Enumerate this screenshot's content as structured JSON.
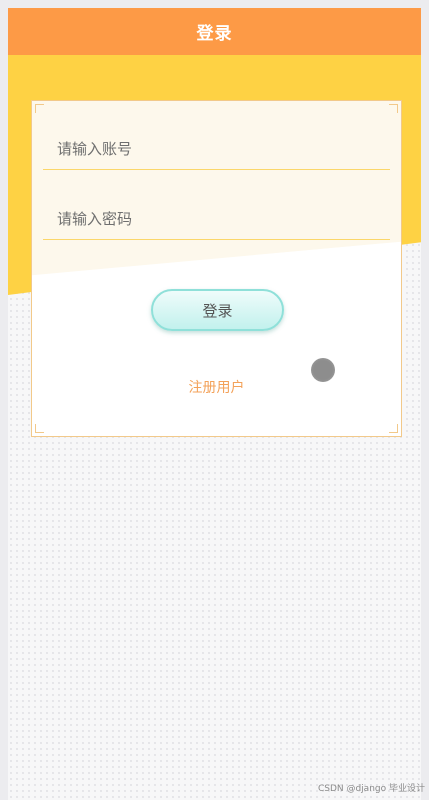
{
  "header": {
    "title": "登录"
  },
  "form": {
    "account_placeholder": "请输入账号",
    "password_placeholder": "请输入密码",
    "login_label": "登录",
    "register_label": "注册用户"
  },
  "watermark": "CSDN @django 毕业设计",
  "colors": {
    "header": "#fd9a46",
    "band": "#fed244",
    "button_border": "#8fe0d9",
    "link": "#f3a25a"
  }
}
